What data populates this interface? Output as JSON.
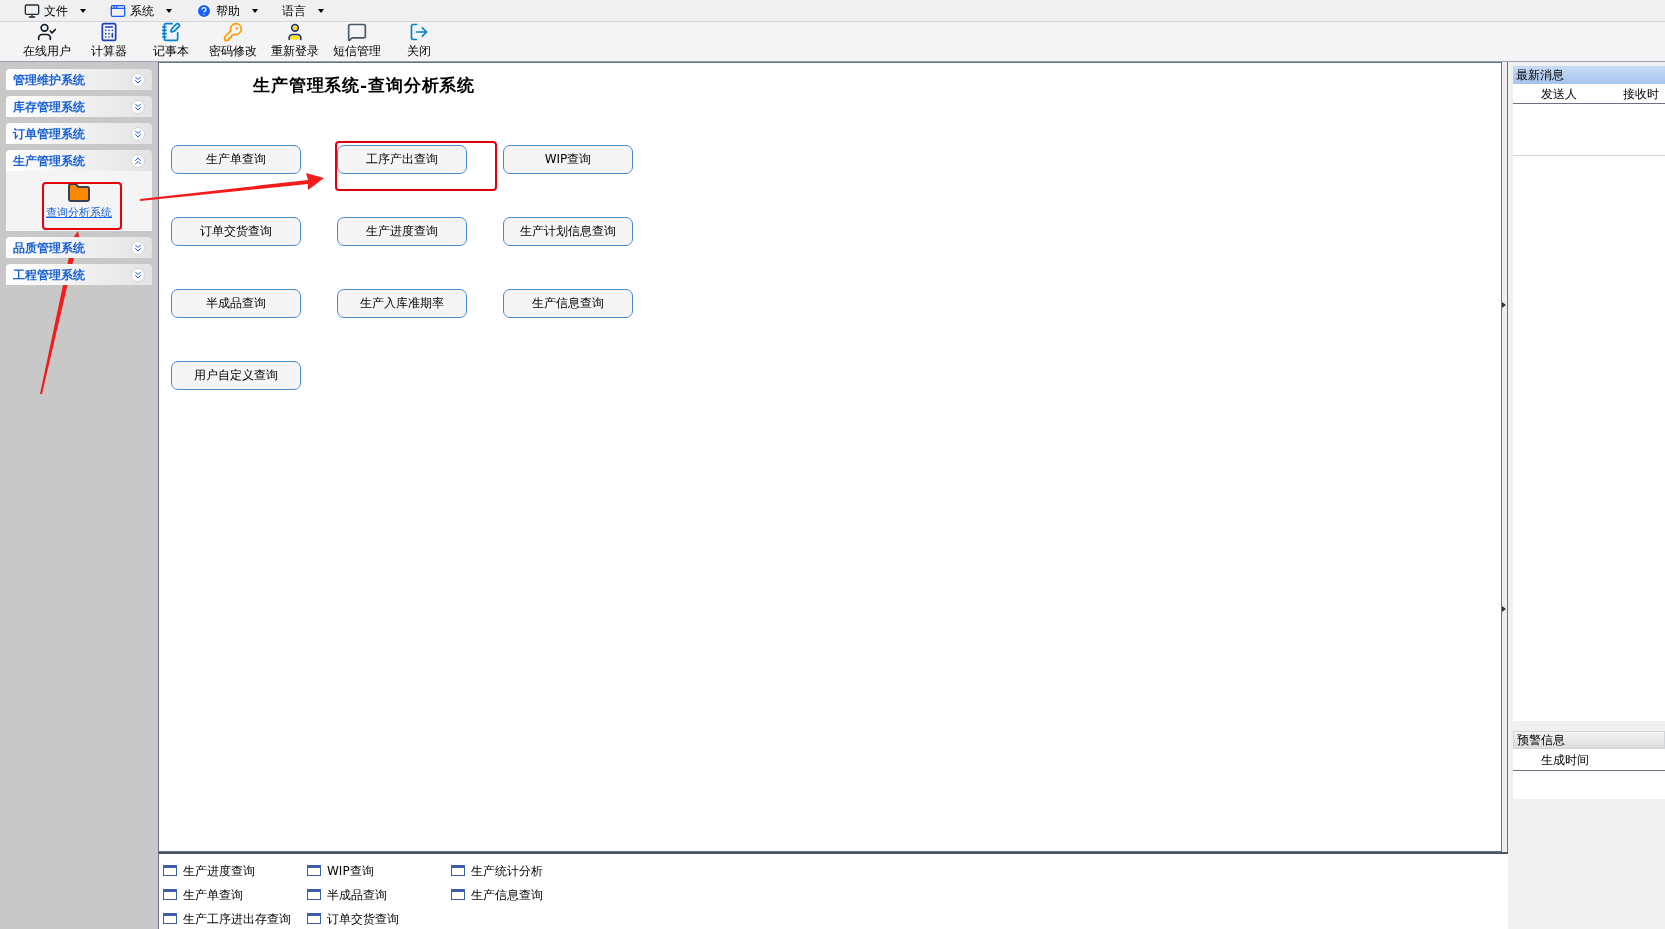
{
  "menu": [
    {
      "label": "文件"
    },
    {
      "label": "系统"
    },
    {
      "label": "帮助"
    },
    {
      "label": "语言"
    }
  ],
  "toolbar": [
    {
      "label": "在线用户"
    },
    {
      "label": "计算器"
    },
    {
      "label": "记事本"
    },
    {
      "label": "密码修改"
    },
    {
      "label": "重新登录"
    },
    {
      "label": "短信管理"
    },
    {
      "label": "关闭"
    }
  ],
  "sidebar": {
    "sections": [
      {
        "label": "管理维护系统",
        "expanded": false
      },
      {
        "label": "库存管理系统",
        "expanded": false
      },
      {
        "label": "订单管理系统",
        "expanded": false
      },
      {
        "label": "生产管理系统",
        "expanded": true,
        "items": [
          {
            "label": "查询分析系统"
          }
        ]
      },
      {
        "label": "品质管理系统",
        "expanded": false
      },
      {
        "label": "工程管理系统",
        "expanded": false
      }
    ]
  },
  "main": {
    "title": "生产管理系统-查询分析系统",
    "buttons": [
      {
        "label": "生产单查询"
      },
      {
        "label": "工序产出查询"
      },
      {
        "label": "WIP查询"
      },
      {
        "label": "订单交货查询"
      },
      {
        "label": "生产进度查询"
      },
      {
        "label": "生产计划信息查询"
      },
      {
        "label": "半成品查询"
      },
      {
        "label": "生产入库准期率"
      },
      {
        "label": "生产信息查询"
      },
      {
        "label": "用户自定义查询"
      }
    ]
  },
  "bottom_links": [
    {
      "label": "生产进度查询"
    },
    {
      "label": "WIP查询"
    },
    {
      "label": "生产统计分析"
    },
    {
      "label": "生产单查询"
    },
    {
      "label": "半成品查询"
    },
    {
      "label": "生产信息查询"
    },
    {
      "label": "生产工序进出存查询"
    },
    {
      "label": "订单交货查询"
    }
  ],
  "messages": {
    "title": "最新消息",
    "columns": [
      "发送人",
      "接收时"
    ]
  },
  "alerts": {
    "title": "预警信息",
    "columns": [
      "生成时间"
    ]
  }
}
